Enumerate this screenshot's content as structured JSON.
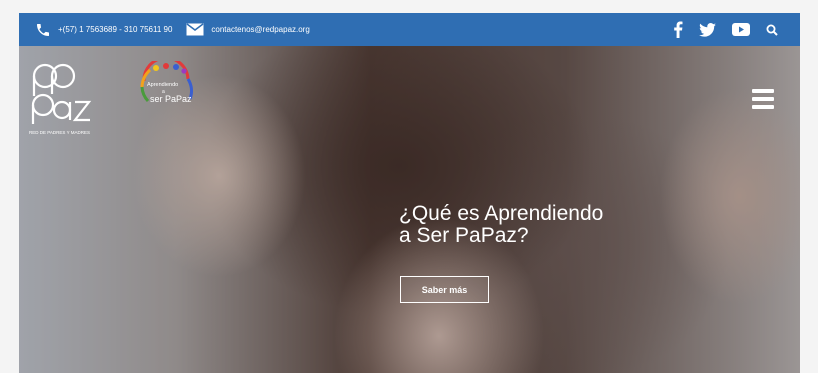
{
  "topbar": {
    "phone": "+(57) 1 7563689 - 310 75611 90",
    "email": "contactenos@redpapaz.org",
    "social_icons": [
      "facebook-icon",
      "twitter-icon",
      "youtube-icon",
      "search-icon"
    ],
    "background": "#2f6eb3"
  },
  "branding": {
    "papaz_logo_text": "PaPaz",
    "papaz_tagline": "RED DE PADRES Y MADRES",
    "aprendiendo_line1": "Aprendiendo",
    "aprendiendo_line2": "a",
    "aprendiendo_line3": "ser PaPaz"
  },
  "hero": {
    "headline_line1": "¿Qué es Aprendiendo",
    "headline_line2": "a Ser PaPaz?",
    "cta_label": "Saber más"
  },
  "menu": {
    "icon": "hamburger-menu-icon"
  }
}
